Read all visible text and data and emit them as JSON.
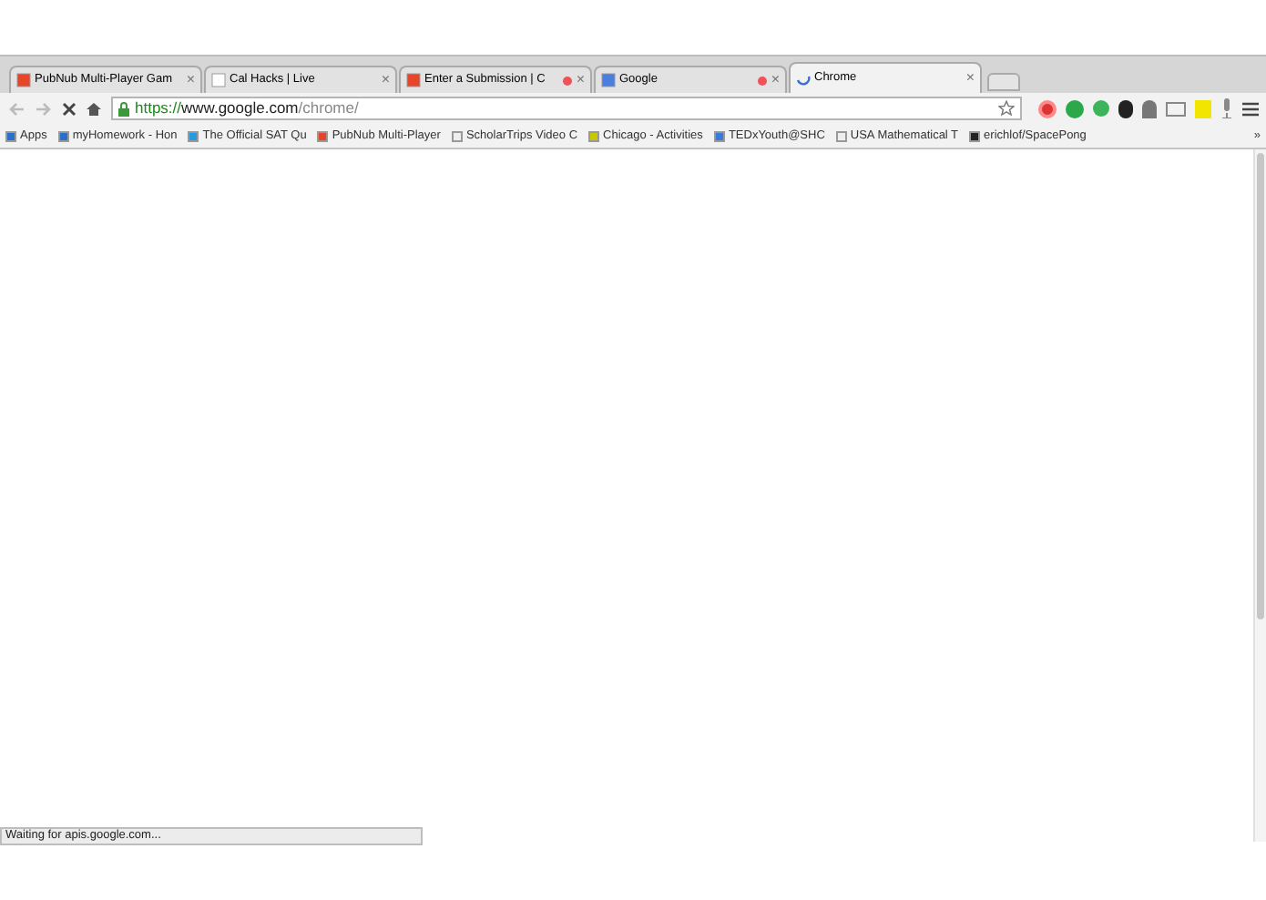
{
  "tabs": [
    {
      "title": "PubNub Multi-Player Gam",
      "close": "×",
      "selected": false,
      "recording": false
    },
    {
      "title": "Cal Hacks | Live",
      "close": "×",
      "selected": false,
      "recording": false
    },
    {
      "title": "Enter a Submission | C",
      "close": "×",
      "selected": false,
      "recording": true
    },
    {
      "title": "Google",
      "close": "×",
      "selected": false,
      "recording": true
    },
    {
      "title": "Chrome",
      "close": "×",
      "selected": true,
      "recording": false
    }
  ],
  "address_bar": {
    "scheme": "https://",
    "host": "www.google.com",
    "path": "/chrome/"
  },
  "bookmarks": [
    {
      "label": "Apps"
    },
    {
      "label": "myHomework - Hon"
    },
    {
      "label": "The Official SAT Qu"
    },
    {
      "label": "PubNub Multi-Player"
    },
    {
      "label": "ScholarTrips Video C"
    },
    {
      "label": "Chicago - Activities"
    },
    {
      "label": "TEDxYouth@SHC"
    },
    {
      "label": "USA Mathematical T"
    },
    {
      "label": "erichlof/SpacePong"
    }
  ],
  "bookmarks_overflow": "»",
  "status_bar": "Waiting for apis.google.com..."
}
